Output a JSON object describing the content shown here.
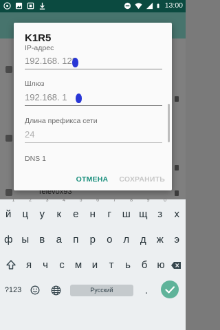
{
  "status_bar": {
    "time": "13:00",
    "icons_left": [
      "whatsapp-icon",
      "image-icon",
      "screenshot-icon",
      "download-icon"
    ],
    "icons_right": [
      "minus-circle-icon",
      "wifi-icon",
      "signal-icon",
      "battery-icon"
    ]
  },
  "background": {
    "visible_item": "Televox93"
  },
  "dialog": {
    "title": "K1R5",
    "fields": [
      {
        "label": "IP-адрес",
        "value": "192.168.   128",
        "disabled": false
      },
      {
        "label": "Шлюз",
        "value": "192.168.   1",
        "disabled": false
      },
      {
        "label": "Длина префикса сети",
        "value": "24",
        "disabled": true
      },
      {
        "label": "DNS 1",
        "value": "",
        "disabled": false
      }
    ],
    "cancel_label": "ОТМЕНА",
    "save_label": "СОХРАНИТЬ"
  },
  "keyboard": {
    "row1": [
      {
        "key": "й",
        "hint": "1"
      },
      {
        "key": "ц",
        "hint": "2"
      },
      {
        "key": "у",
        "hint": "3"
      },
      {
        "key": "к",
        "hint": "4"
      },
      {
        "key": "е",
        "hint": "5"
      },
      {
        "key": "н",
        "hint": "6"
      },
      {
        "key": "г",
        "hint": "7"
      },
      {
        "key": "ш",
        "hint": "8"
      },
      {
        "key": "щ",
        "hint": "9"
      },
      {
        "key": "з",
        "hint": "0"
      },
      {
        "key": "х",
        "hint": ""
      }
    ],
    "row2": [
      "ф",
      "ы",
      "в",
      "а",
      "п",
      "р",
      "о",
      "л",
      "д",
      "ж",
      "э"
    ],
    "row3": [
      "я",
      "ч",
      "с",
      "м",
      "и",
      "т",
      "ь",
      "б",
      "ю"
    ],
    "symbols_label": "?123",
    "space_label": "Русский",
    "dot_label": "."
  }
}
